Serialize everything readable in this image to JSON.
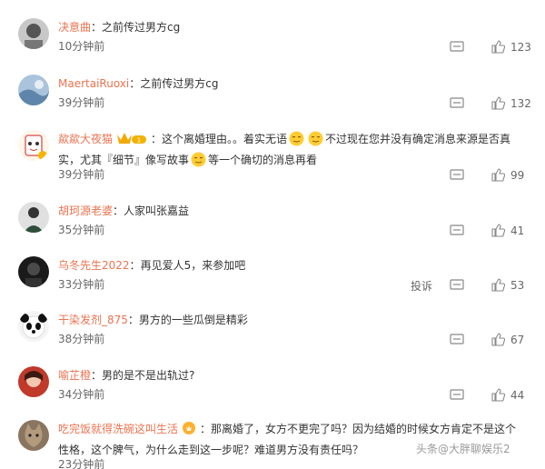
{
  "comments": [
    {
      "user": "决意曲",
      "text": "之前传过男方cg",
      "time": "10分钟前",
      "likes": "123",
      "avatar": "avatar-gray"
    },
    {
      "user": "MaertaiRuoxi",
      "text": "之前传过男方cg",
      "time": "39分钟前",
      "likes": "132",
      "avatar": "avatar-blue"
    },
    {
      "user": "歘歘大夜猫",
      "text_a": "这个离婚理由。。着实无语",
      "text_b": "不过现在您并没有确定消息来源是否真实，尤其『细节』像写故事",
      "text_c": "等一个确切的消息再看",
      "time": "39分钟前",
      "likes": "99",
      "avatar": "avatar-cartoon"
    },
    {
      "user": "胡珂源老婆",
      "text": "人家叫张嘉益",
      "time": "35分钟前",
      "likes": "41",
      "avatar": "avatar-person"
    },
    {
      "user": "乌冬先生2022",
      "text": "再见爱人5，来参加吧",
      "time": "33分钟前",
      "report": "投诉",
      "likes": "53",
      "avatar": "avatar-dark"
    },
    {
      "user": "干染发剂_875",
      "text": "男方的一些瓜倒是精彩",
      "time": "38分钟前",
      "likes": "67",
      "avatar": "avatar-panda"
    },
    {
      "user": "喻芷橙",
      "text": "男的是不是出轨过?",
      "time": "34分钟前",
      "likes": "44",
      "avatar": "avatar-red"
    },
    {
      "user": "吃完饭就得洗碗这叫生活",
      "text": "那离婚了，女方不更完了吗？因为结婚的时候女方肯定不是这个性格，这个脾气，为什么走到这一步呢？难道男方没有责任吗？",
      "time": "23分钟前",
      "avatar": "avatar-cat"
    }
  ],
  "separator": "：",
  "watermark": "头条@大胖聊娱乐2",
  "colors": {
    "username": "#eb7350",
    "text": "#333333",
    "meta": "#666666"
  }
}
